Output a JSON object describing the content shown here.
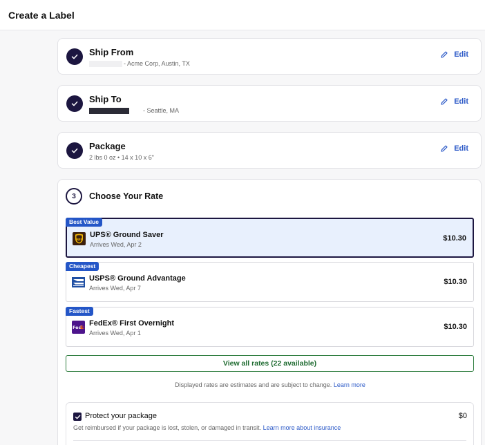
{
  "header": {
    "title": "Create a Label"
  },
  "steps": {
    "ship_from": {
      "title": "Ship From",
      "address": "- Acme Corp, Austin, TX",
      "edit": "Edit"
    },
    "ship_to": {
      "title": "Ship To",
      "address": "- Seattle, MA",
      "edit": "Edit"
    },
    "package": {
      "title": "Package",
      "details": "2 lbs 0 oz  •  14 x 10 x  6\"",
      "edit": "Edit"
    }
  },
  "rate": {
    "step_number": "3",
    "title": "Choose Your Rate",
    "options": [
      {
        "badge": "Best Value",
        "carrier": "UPS",
        "service": "UPS® Ground Saver",
        "eta": "Arrives Wed, Apr 2",
        "price": "$10.30",
        "selected": true
      },
      {
        "badge": "Cheapest",
        "carrier": "USPS",
        "service": "USPS® Ground Advantage",
        "eta": "Arrives Wed, Apr 7",
        "price": "$10.30",
        "selected": false
      },
      {
        "badge": "Fastest",
        "carrier": "FedEx",
        "service": "FedEx® First Overnight",
        "eta": "Arrives Wed, Apr 1",
        "price": "$10.30",
        "selected": false
      }
    ],
    "view_all": "View all rates (22 available)",
    "disclaimer": "Displayed rates are estimates and are subject to change.",
    "disclaimer_link": "Learn more"
  },
  "protection": {
    "checked": true,
    "title": "Protect your package",
    "price": "$0",
    "subtitle": "Get reimbursed if your package is lost, stolen, or damaged in transit.",
    "link": "Learn more about insurance"
  },
  "colors": {
    "accent_dark": "#1c1640",
    "link_blue": "#2a58c7",
    "badge_blue": "#2456c7",
    "selected_bg": "#e8f0fd",
    "green": "#2e7d3e"
  },
  "icons": [
    "check-icon",
    "pencil-icon",
    "ups-logo-icon",
    "usps-logo-icon",
    "fedex-logo-icon",
    "checkbox-check-icon"
  ]
}
